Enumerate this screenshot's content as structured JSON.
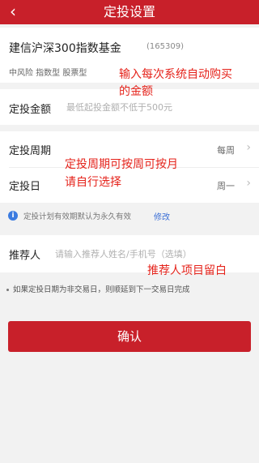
{
  "header": {
    "title": "定投设置",
    "back_icon": "chevron-left-icon"
  },
  "fund": {
    "name": "建信沪深300指数基金",
    "code": "(165309)",
    "tags": "中风险 指数型 股票型"
  },
  "amount": {
    "label": "定投金额",
    "placeholder": "最低起投金额不低于500元"
  },
  "cycle": {
    "label": "定投周期",
    "value": "每周"
  },
  "day": {
    "label": "定投日",
    "value": "周一"
  },
  "info": {
    "text": "定投计划有效期默认为永久有效",
    "modify_label": "修改"
  },
  "referrer": {
    "label": "推荐人",
    "placeholder": "请输入推荐人姓名/手机号（选填）"
  },
  "note": {
    "text": "如果定投日期为非交易日，则顺延到下一交易日完成"
  },
  "confirm_label": "确认",
  "annotations": {
    "fund_line1": "输入每次系统自动购买",
    "fund_line2": "的金额",
    "cycle_line1": "定投周期可按周可按月",
    "cycle_line2": "请自行选择",
    "referrer": "推荐人项目留白"
  },
  "colors": {
    "brand_red": "#c8202a",
    "annotation_red": "#e5231b",
    "link_blue": "#3b6fd6"
  }
}
